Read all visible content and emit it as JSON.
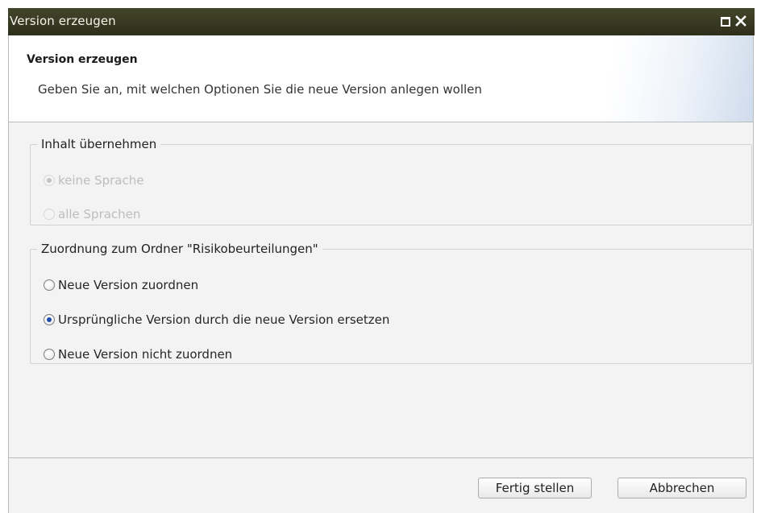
{
  "window": {
    "title": "Version erzeugen",
    "titlebar_color": "#33351f"
  },
  "header": {
    "title": "Version erzeugen",
    "subtitle": "Geben Sie an, mit welchen Optionen Sie die neue Version anlegen wollen"
  },
  "content_group": {
    "legend": "Inhalt übernehmen",
    "options": [
      {
        "label": "keine Sprache",
        "checked": true,
        "disabled": true
      },
      {
        "label": "alle Sprachen",
        "checked": false,
        "disabled": true
      }
    ]
  },
  "folder_group": {
    "legend": "Zuordnung zum Ordner \"Risikobeurteilungen\"",
    "options": [
      {
        "label": "Neue Version zuordnen",
        "checked": false,
        "disabled": false
      },
      {
        "label": "Ursprüngliche Version durch die neue Version ersetzen",
        "checked": true,
        "disabled": false
      },
      {
        "label": "Neue Version nicht zuordnen",
        "checked": false,
        "disabled": false
      }
    ]
  },
  "buttons": {
    "finish": "Fertig stellen",
    "cancel": "Abbrechen"
  },
  "icons": {
    "maximize": "maximize-icon",
    "close": "close-icon"
  },
  "colors": {
    "radio_selected": "#1f4fa8",
    "disabled_text": "#bdbdbd"
  }
}
